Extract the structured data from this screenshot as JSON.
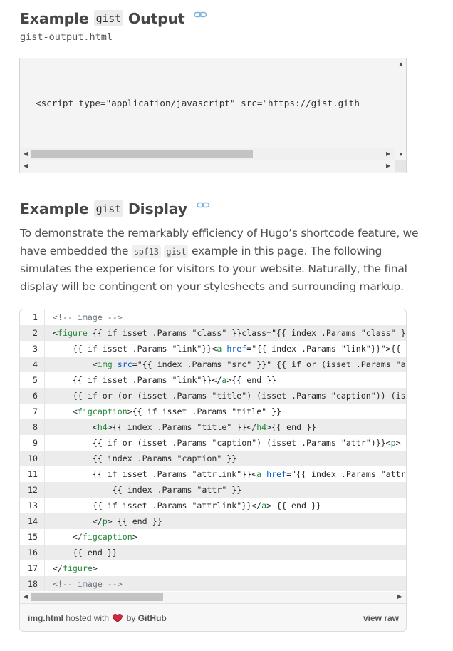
{
  "section1": {
    "heading_prefix": "Example",
    "heading_code": "gist",
    "heading_suffix": "Output",
    "filename": "gist-output.html",
    "code": "<script type=\"application/javascript\" src=\"https://gist.gith"
  },
  "section2": {
    "heading_prefix": "Example",
    "heading_code": "gist",
    "heading_suffix": "Display",
    "para_part1": "To demonstrate the remarkably efficiency of Hugo’s shortcode feature, we have embedded the",
    "para_code1": "spf13",
    "para_code2": "gist",
    "para_part2": "example in this page. The following simulates the experience for visitors to your website. Naturally, the final display will be contingent on your stylesheets and surrounding markup."
  },
  "gist": {
    "lines": [
      {
        "n": "1",
        "t": "<!-- image -->"
      },
      {
        "n": "2",
        "t": "<figure {{ if isset .Params \"class\" }}class=\"{{ index .Params \"class\" }}\"{{"
      },
      {
        "n": "3",
        "t": "    {{ if isset .Params \"link\"}}<a href=\"{{ index .Params \"link\"}}\">{{ end"
      },
      {
        "n": "4",
        "t": "        <img src=\"{{ index .Params \"src\" }}\" {{ if or (isset .Params \"alt\")"
      },
      {
        "n": "5",
        "t": "    {{ if isset .Params \"link\"}}</a>{{ end }}"
      },
      {
        "n": "6",
        "t": "    {{ if or (or (isset .Params \"title\") (isset .Params \"caption\")) (isset"
      },
      {
        "n": "7",
        "t": "    <figcaption>{{ if isset .Params \"title\" }}"
      },
      {
        "n": "8",
        "t": "        <h4>{{ index .Params \"title\" }}</h4>{{ end }}"
      },
      {
        "n": "9",
        "t": "        {{ if or (isset .Params \"caption\") (isset .Params \"attr\")}}<p>"
      },
      {
        "n": "10",
        "t": "        {{ index .Params \"caption\" }}"
      },
      {
        "n": "11",
        "t": "        {{ if isset .Params \"attrlink\"}}<a href=\"{{ index .Params \"attrlink"
      },
      {
        "n": "12",
        "t": "            {{ index .Params \"attr\" }}"
      },
      {
        "n": "13",
        "t": "        {{ if isset .Params \"attrlink\"}}</a> {{ end }}"
      },
      {
        "n": "14",
        "t": "        </p> {{ end }}"
      },
      {
        "n": "15",
        "t": "    </figcaption>"
      },
      {
        "n": "16",
        "t": "    {{ end }}"
      },
      {
        "n": "17",
        "t": "</figure>"
      },
      {
        "n": "18",
        "t": "<!-- image -->"
      }
    ],
    "footer_file": "img.html",
    "footer_hosted": "hosted with",
    "footer_by": "by",
    "footer_github": "GitHub",
    "footer_view_raw": "view raw",
    "heart_color": "#d2283c"
  }
}
